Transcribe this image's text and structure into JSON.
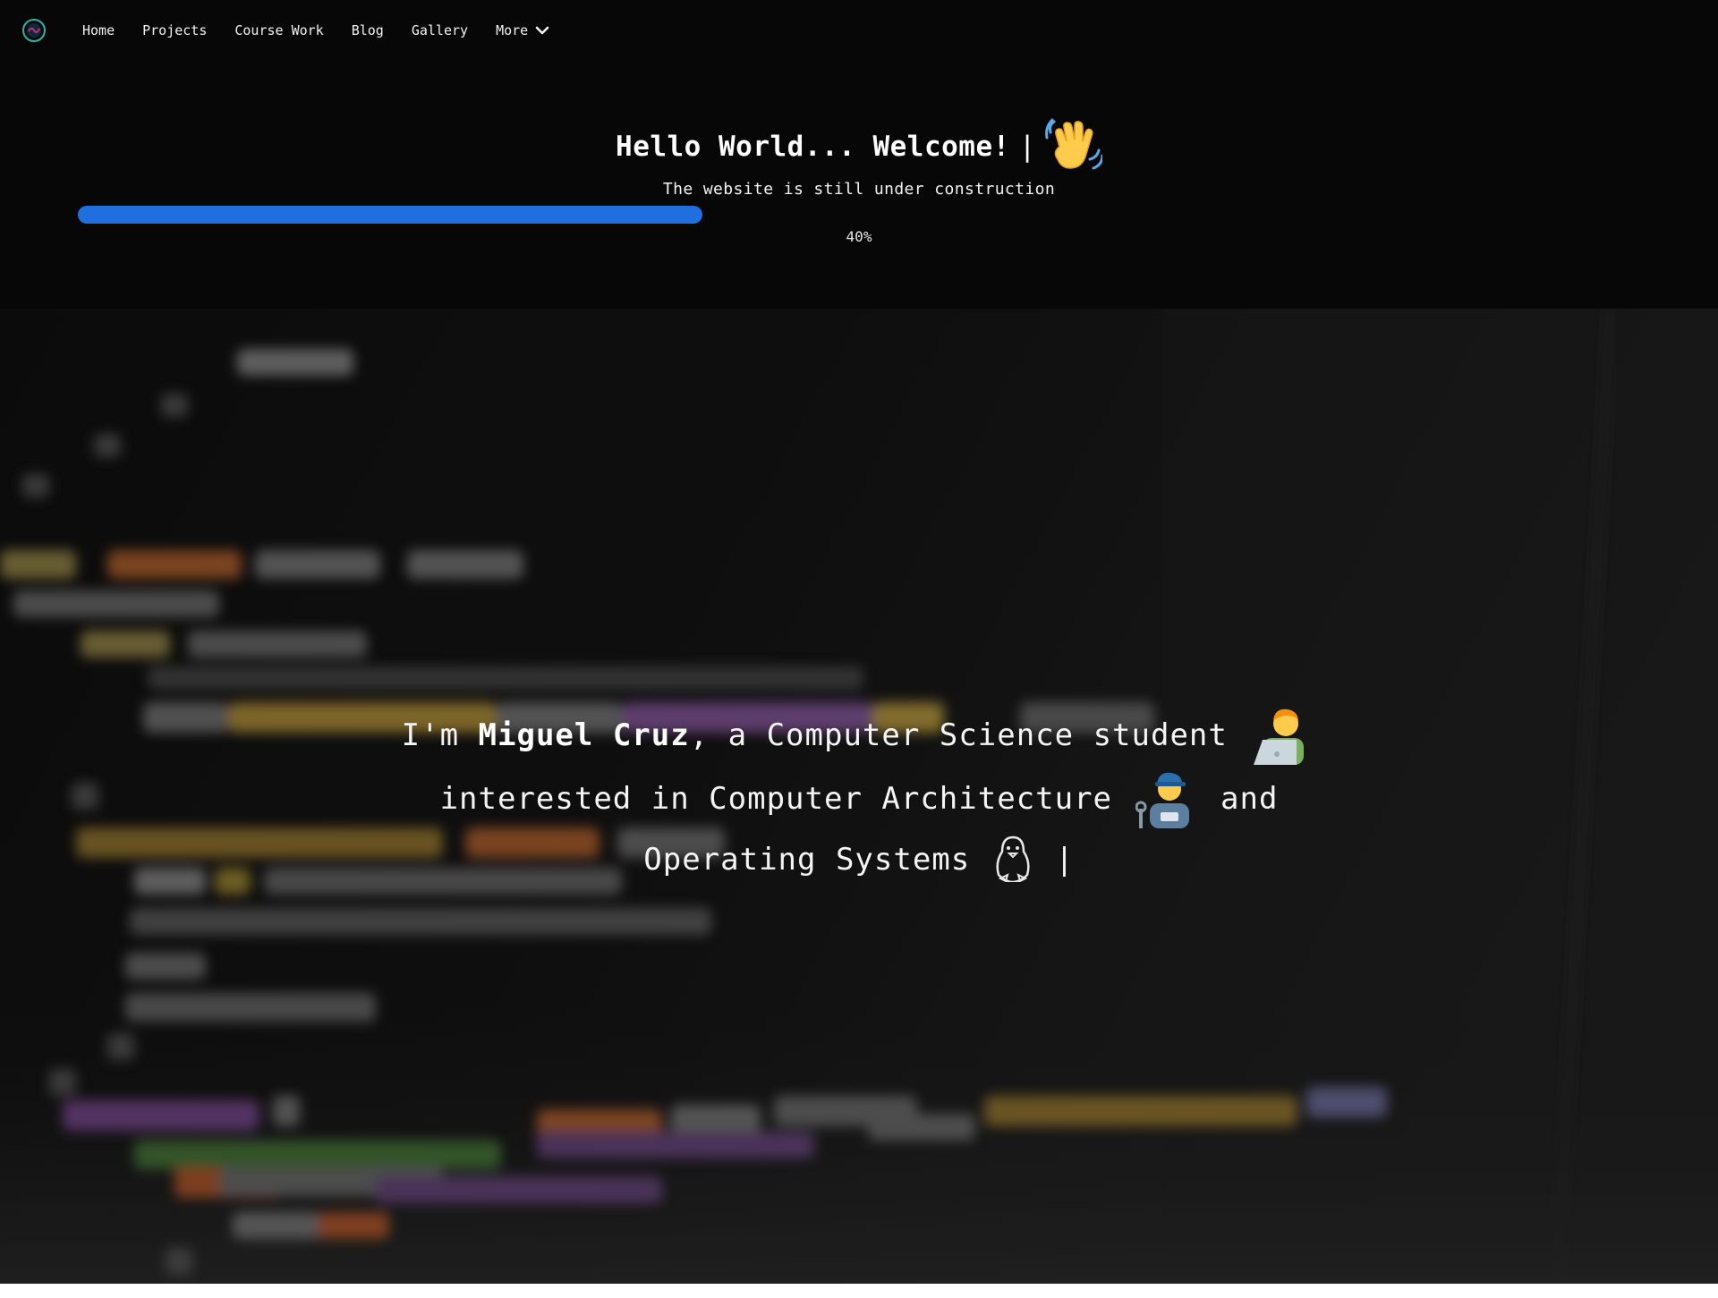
{
  "nav": {
    "logo": "site-logo-icon",
    "items": [
      {
        "label": "Home"
      },
      {
        "label": "Projects"
      },
      {
        "label": "Course Work"
      },
      {
        "label": "Blog"
      },
      {
        "label": "Gallery"
      },
      {
        "label": "More",
        "icon": "chevron-down-icon"
      }
    ]
  },
  "banner": {
    "greeting": "Hello World... Welcome!",
    "cursor": "|",
    "greeting_icon": "waving-hand-icon",
    "notice": "The website is still under construction",
    "progress": {
      "value": 40,
      "label": "40%"
    },
    "colors": {
      "progress": "#1f6fde",
      "background": "#070707"
    }
  },
  "hero": {
    "prefix": "I'm ",
    "name": "Miguel Cruz",
    "line1_rest": ", a Computer Science student",
    "line2_start": "interested in Computer Architecture",
    "line2_end": "and",
    "line3": "Operating Systems",
    "cursor": "|",
    "icons": [
      "technologist-icon",
      "mechanic-icon",
      "penguin-icon"
    ],
    "background": "blurred-code-background"
  }
}
